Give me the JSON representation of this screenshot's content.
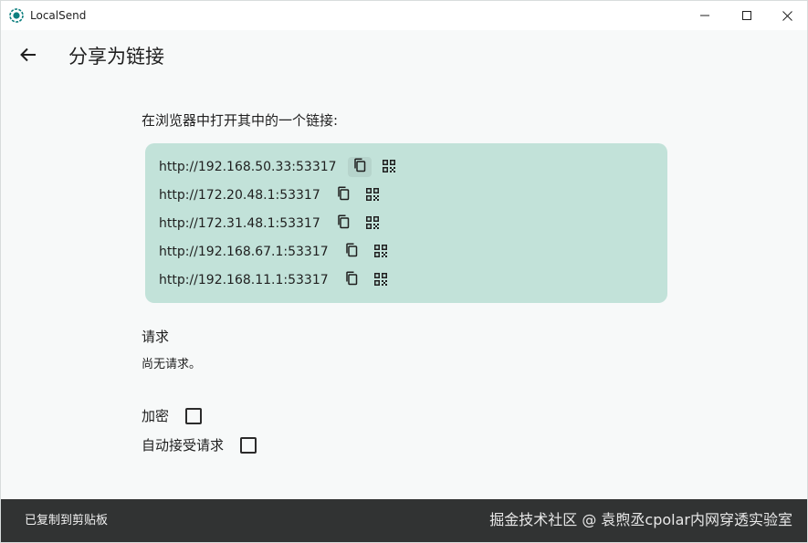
{
  "window": {
    "title": "LocalSend",
    "app_icon": "localsend-logo-icon",
    "controls": [
      "minimize-icon",
      "maximize-icon",
      "close-icon"
    ]
  },
  "header": {
    "back_icon": "arrow-left-icon",
    "title": "分享为链接"
  },
  "links_section": {
    "instruction": "在浏览器中打开其中的一个链接:",
    "card_color": "#c2e2d9",
    "links": [
      {
        "url": "http://192.168.50.33:53317"
      },
      {
        "url": "http://172.20.48.1:53317"
      },
      {
        "url": "http://172.31.48.1:53317"
      },
      {
        "url": "http://192.168.67.1:53317"
      },
      {
        "url": "http://192.168.11.1:53317"
      }
    ],
    "row_icons": [
      "copy-icon",
      "qr-code-icon"
    ]
  },
  "requests": {
    "title": "请求",
    "empty_text": "尚无请求。"
  },
  "options": [
    {
      "label": "加密",
      "checked": false
    },
    {
      "label": "自动接受请求",
      "checked": false
    }
  ],
  "snackbar": {
    "text": "已复制到剪贴板",
    "background": "#313333"
  },
  "watermark": "掘金技术社区 @ 袁煦丞cpolar内网穿透实验室",
  "colors": {
    "accent": "#008080",
    "background": "#f7f9f9"
  }
}
